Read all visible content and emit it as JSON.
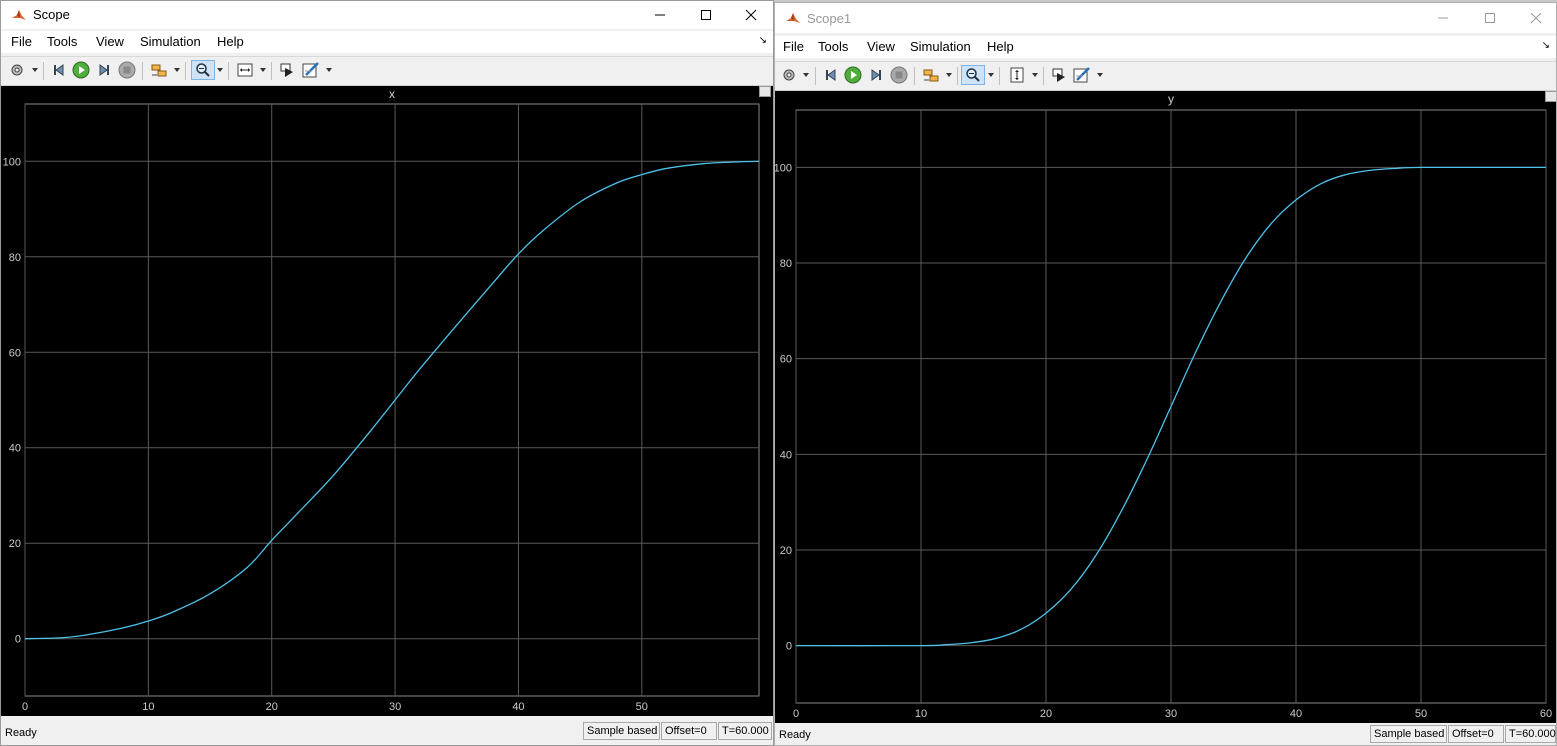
{
  "windows": [
    {
      "title": "Scope",
      "menu": [
        "File",
        "Tools",
        "View",
        "Simulation",
        "Help"
      ],
      "plot_title": "x",
      "status": {
        "ready": "Ready",
        "mode": "Sample based",
        "offset": "Offset=0",
        "time": "T=60.000"
      }
    },
    {
      "title": "Scope1",
      "menu": [
        "File",
        "Tools",
        "View",
        "Simulation",
        "Help"
      ],
      "plot_title": "y",
      "status": {
        "ready": "Ready",
        "mode": "Sample based",
        "offset": "Offset=0",
        "time": "T=60.000"
      }
    }
  ],
  "toolbar_icons": [
    "gear-icon",
    "step-back-icon",
    "run-icon",
    "step-forward-icon",
    "stop-icon",
    "signal-select-icon",
    "zoom-icon",
    "scale-axes-icon",
    "highlight-block-icon",
    "edit-style-icon"
  ],
  "colors": {
    "plot_bg": "#000000",
    "grid": "#5a5a5a",
    "trace": "#4fc1e9",
    "tick_text": "#cccccc",
    "title_text": "#cccccc"
  },
  "chart_data": [
    {
      "type": "line",
      "title": "x",
      "xlim": [
        0,
        59.5
      ],
      "ylim": [
        -12,
        112
      ],
      "xticks": [
        0,
        10,
        20,
        30,
        40,
        50
      ],
      "yticks": [
        0,
        20,
        40,
        60,
        80,
        100
      ],
      "grid": true,
      "series": [
        {
          "x": [
            0,
            3,
            5,
            8,
            10,
            12,
            15,
            18,
            20,
            22,
            25,
            28,
            30,
            32,
            35,
            38,
            40,
            42,
            45,
            48,
            50,
            52,
            55,
            58,
            59.5
          ],
          "values": [
            0,
            0.2,
            0.8,
            2.3,
            3.7,
            5.6,
            9.4,
            14.9,
            20.6,
            26,
            34.2,
            43.5,
            50,
            56.5,
            65.7,
            74.7,
            80.6,
            85.5,
            91.5,
            95.5,
            97.2,
            98.5,
            99.5,
            99.9,
            100
          ]
        }
      ]
    },
    {
      "type": "line",
      "title": "y",
      "xlim": [
        0,
        60
      ],
      "ylim": [
        -12,
        112
      ],
      "xticks": [
        0,
        10,
        20,
        30,
        40,
        50,
        60
      ],
      "yticks": [
        0,
        20,
        40,
        60,
        80,
        100
      ],
      "grid": true,
      "series": [
        {
          "x": [
            0,
            10,
            12,
            14,
            16,
            18,
            20,
            22,
            24,
            26,
            28,
            30,
            32,
            34,
            36,
            38,
            40,
            42,
            44,
            46,
            48,
            50,
            55,
            60
          ],
          "values": [
            0,
            0,
            0.2,
            0.6,
            1.5,
            3.4,
            6.8,
            11.8,
            18.9,
            28,
            38.5,
            50,
            61.5,
            72,
            81.1,
            88.2,
            93.2,
            96.6,
            98.5,
            99.4,
            99.8,
            100,
            100,
            100
          ]
        }
      ]
    }
  ]
}
